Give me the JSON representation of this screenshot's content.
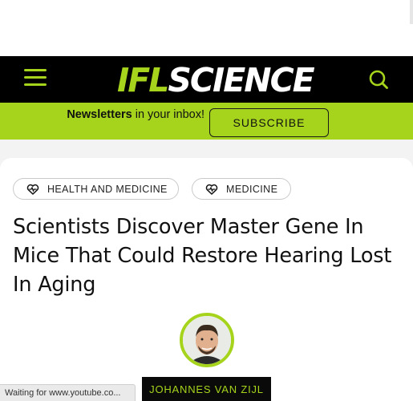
{
  "logo": {
    "part1": "IFL",
    "part2": "SCIENCE"
  },
  "colors": {
    "brand_green": "#a6d41c",
    "nav_bg": "#000000"
  },
  "newsletter": {
    "bold": "Newsletters",
    "rest": " in your inbox!",
    "button": "SUBSCRIBE"
  },
  "tags": [
    {
      "icon": "heart-pulse-icon",
      "label": "HEALTH AND MEDICINE"
    },
    {
      "icon": "heart-pulse-icon",
      "label": "MEDICINE"
    }
  ],
  "article": {
    "headline": "Scientists Discover Master Gene In Mice That Could Restore Hearing Lost In Aging",
    "author": "JOHANNES VAN ZIJL"
  },
  "status": {
    "text": "Waiting for www.youtube.co..."
  }
}
